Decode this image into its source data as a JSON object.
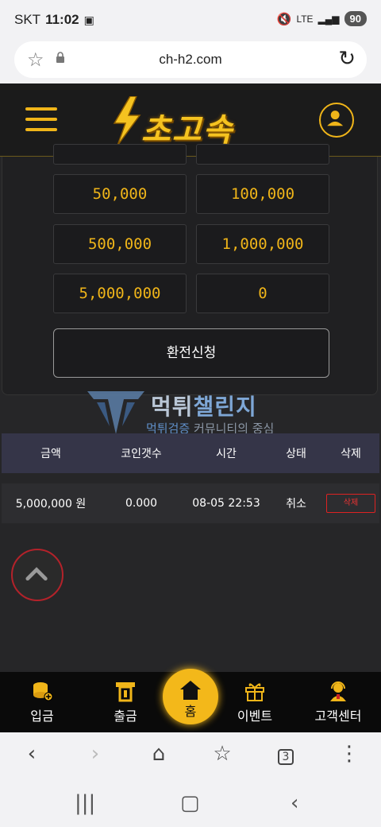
{
  "status": {
    "carrier": "SKT",
    "time": "11:02",
    "network": "LTE",
    "battery": "90"
  },
  "browser": {
    "url": "ch-h2.com",
    "tab_count": "3"
  },
  "header": {
    "logo_text": "초고속"
  },
  "amounts": [
    "50,000",
    "100,000",
    "500,000",
    "1,000,000",
    "5,000,000",
    "0"
  ],
  "exchange_button": "환전신청",
  "watermark": {
    "title_a": "먹튀",
    "title_b": "챌린지",
    "sub_a": "먹튀검증",
    "sub_b": " 커뮤니티의 중심"
  },
  "table": {
    "headers": [
      "금액",
      "코인갯수",
      "시간",
      "상태",
      "삭제"
    ],
    "rows": [
      {
        "amount": "5,000,000 원",
        "coins": "0.000",
        "time": "08-05 22:53",
        "status": "취소",
        "delete": "삭제"
      }
    ]
  },
  "nav": {
    "deposit": "입금",
    "withdraw": "출금",
    "home": "홈",
    "event": "이벤트",
    "support": "고객센터"
  },
  "colors": {
    "accent": "#f0b519",
    "danger": "#dd2222",
    "table_header": "#353548"
  }
}
